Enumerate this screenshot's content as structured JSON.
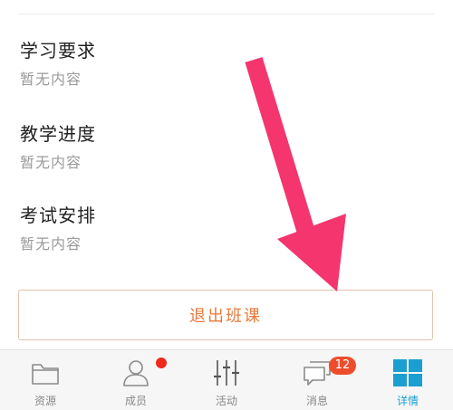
{
  "sections": [
    {
      "title": "学习要求",
      "body": "暂无内容"
    },
    {
      "title": "教学进度",
      "body": "暂无内容"
    },
    {
      "title": "考试安排",
      "body": "暂无内容"
    }
  ],
  "exit_button": {
    "label": "退出班课"
  },
  "tabbar": {
    "tabs": [
      {
        "label": "资源",
        "icon": "folder-icon"
      },
      {
        "label": "成员",
        "icon": "person-icon"
      },
      {
        "label": "活动",
        "icon": "sliders-icon"
      },
      {
        "label": "消息",
        "icon": "chat-icon",
        "badge": "12"
      },
      {
        "label": "详情",
        "icon": "grid-icon",
        "active": true
      }
    ]
  },
  "colors": {
    "accent": "#1a9fd0",
    "button_text": "#e8793a",
    "badge": "#ee2a1c",
    "arrow": "#f4356e"
  }
}
